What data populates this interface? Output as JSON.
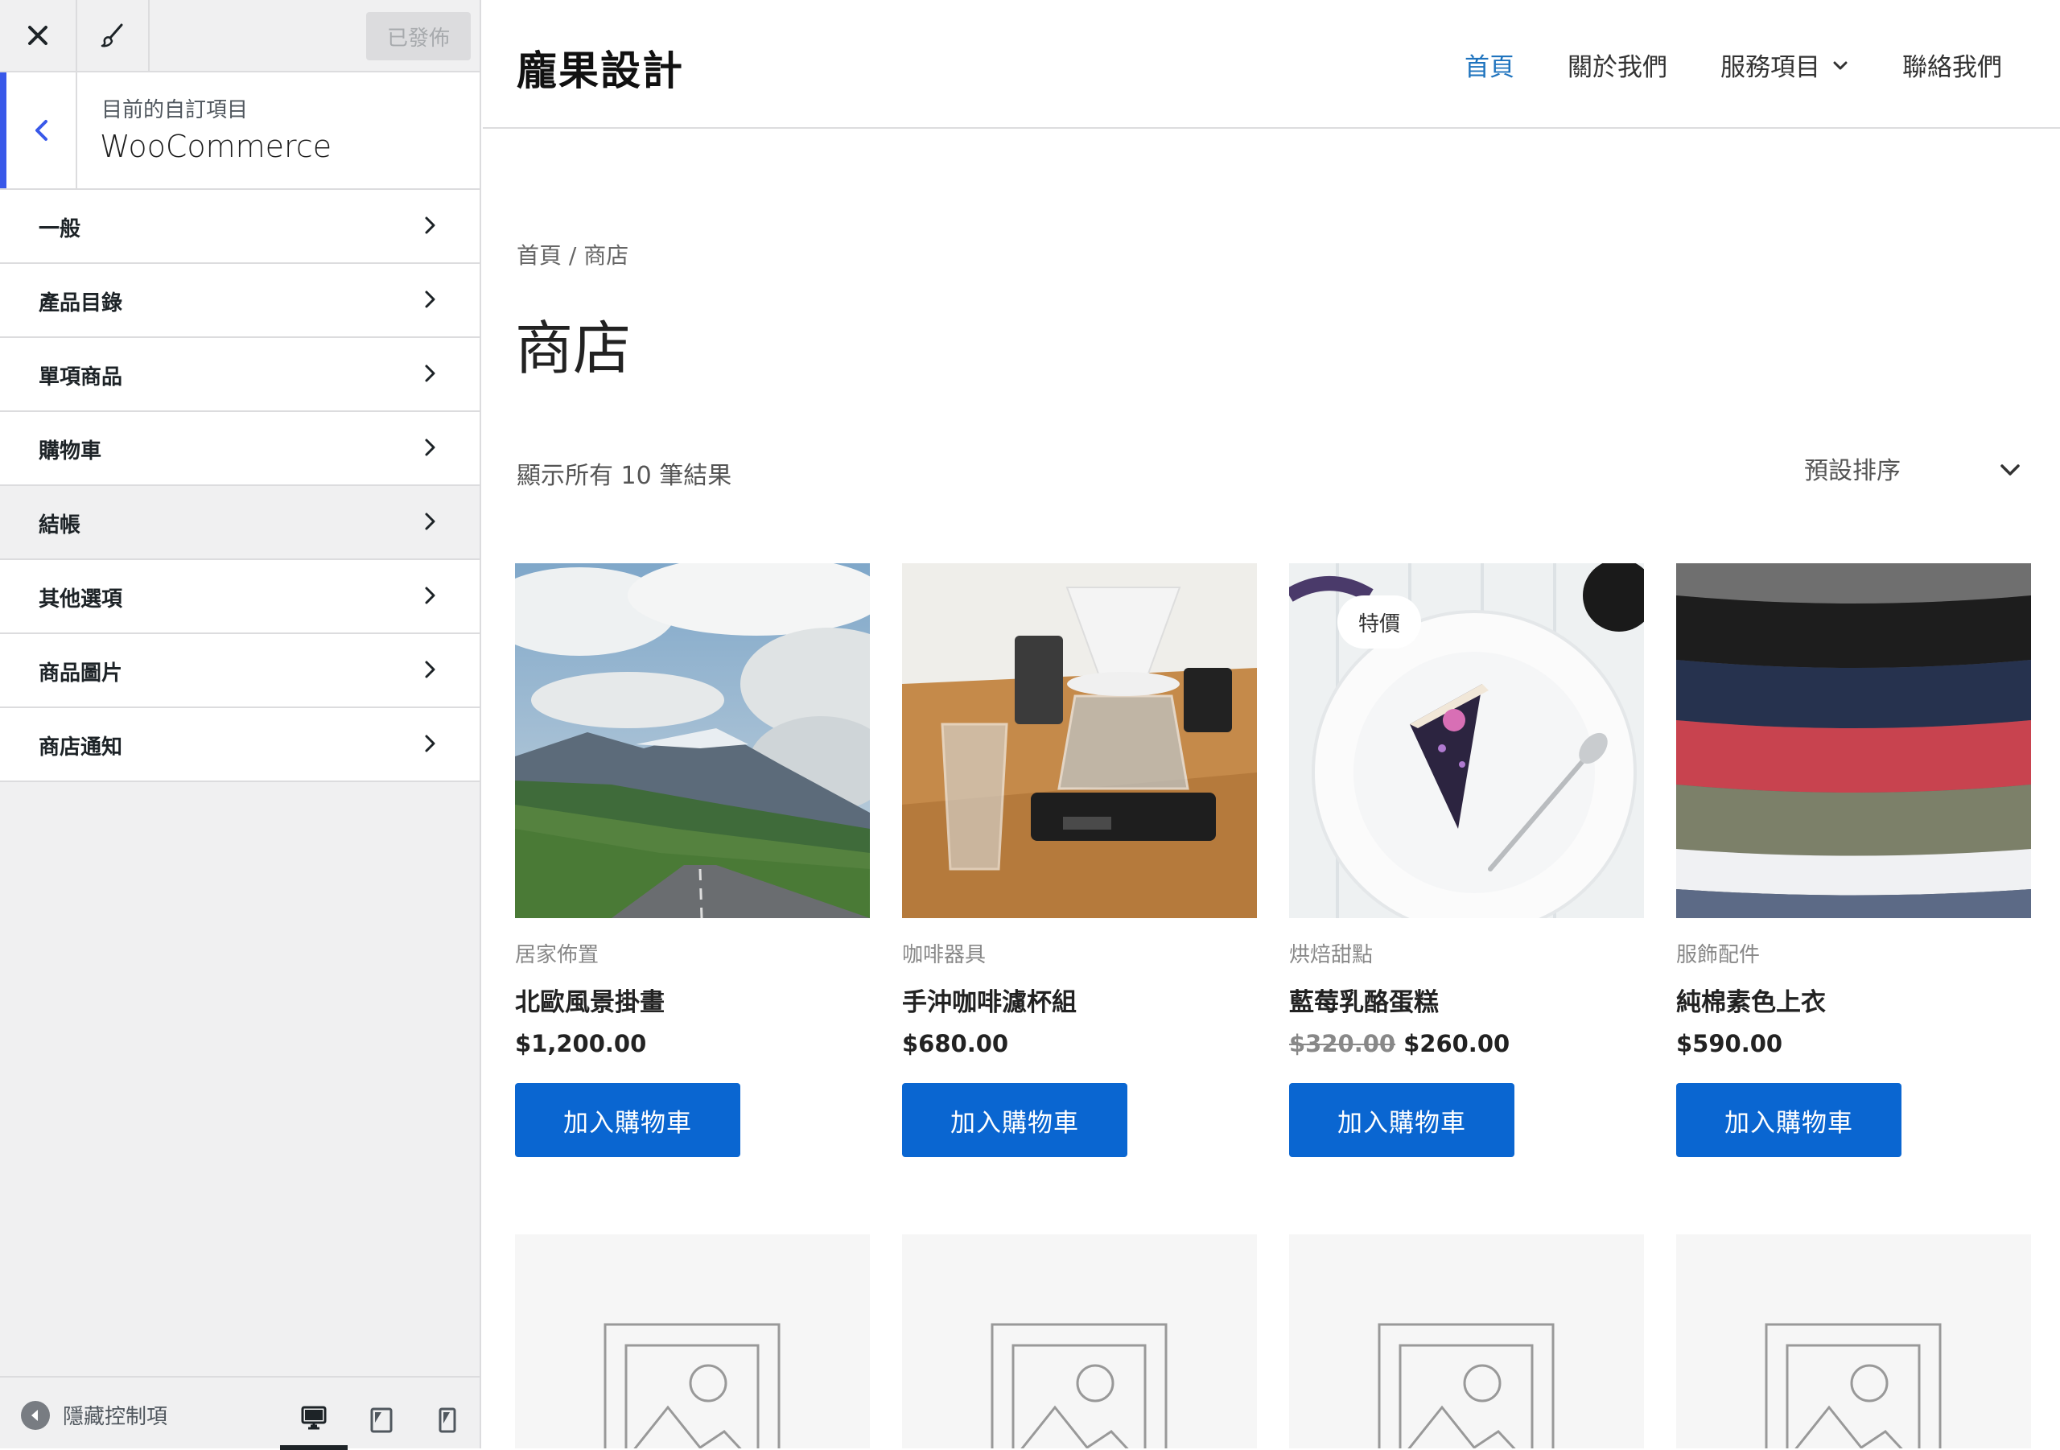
{
  "customizer": {
    "publish_label": "已發佈",
    "section_label": "目前的自訂項目",
    "section_title": "WooCommerce",
    "menu": [
      {
        "label": "一般"
      },
      {
        "label": "產品目錄"
      },
      {
        "label": "單項商品"
      },
      {
        "label": "購物車"
      },
      {
        "label": "結帳"
      },
      {
        "label": "其他選項"
      },
      {
        "label": "商品圖片"
      },
      {
        "label": "商店通知"
      }
    ],
    "hide_controls_label": "隱藏控制項"
  },
  "site": {
    "title": "龐果設計",
    "nav": [
      {
        "label": "首頁"
      },
      {
        "label": "關於我們"
      },
      {
        "label": "服務項目"
      },
      {
        "label": "聯絡我們"
      }
    ]
  },
  "shop": {
    "breadcrumb": "首頁 / 商店",
    "title": "商店",
    "result_count": "顯示所有 10 筆結果",
    "orderby": "預設排序",
    "sale_badge": "特價",
    "products": [
      {
        "category": "居家佈置",
        "name": "北歐風景掛畫",
        "price": "$1,200.00",
        "button": "加入購物車"
      },
      {
        "category": "咖啡器具",
        "name": "手沖咖啡濾杯組",
        "price": "$680.00",
        "button": "加入購物車"
      },
      {
        "category": "烘焙甜點",
        "name": "藍莓乳酪蛋糕",
        "regular_price": "$320.00",
        "price": "$260.00",
        "button": "加入購物車"
      },
      {
        "category": "服飾配件",
        "name": "純棉素色上衣",
        "price": "$590.00",
        "button": "加入購物車"
      }
    ]
  },
  "colors": {
    "accent": "#3858e9",
    "button": "#0a66d1",
    "nav_current": "#1e73be"
  }
}
